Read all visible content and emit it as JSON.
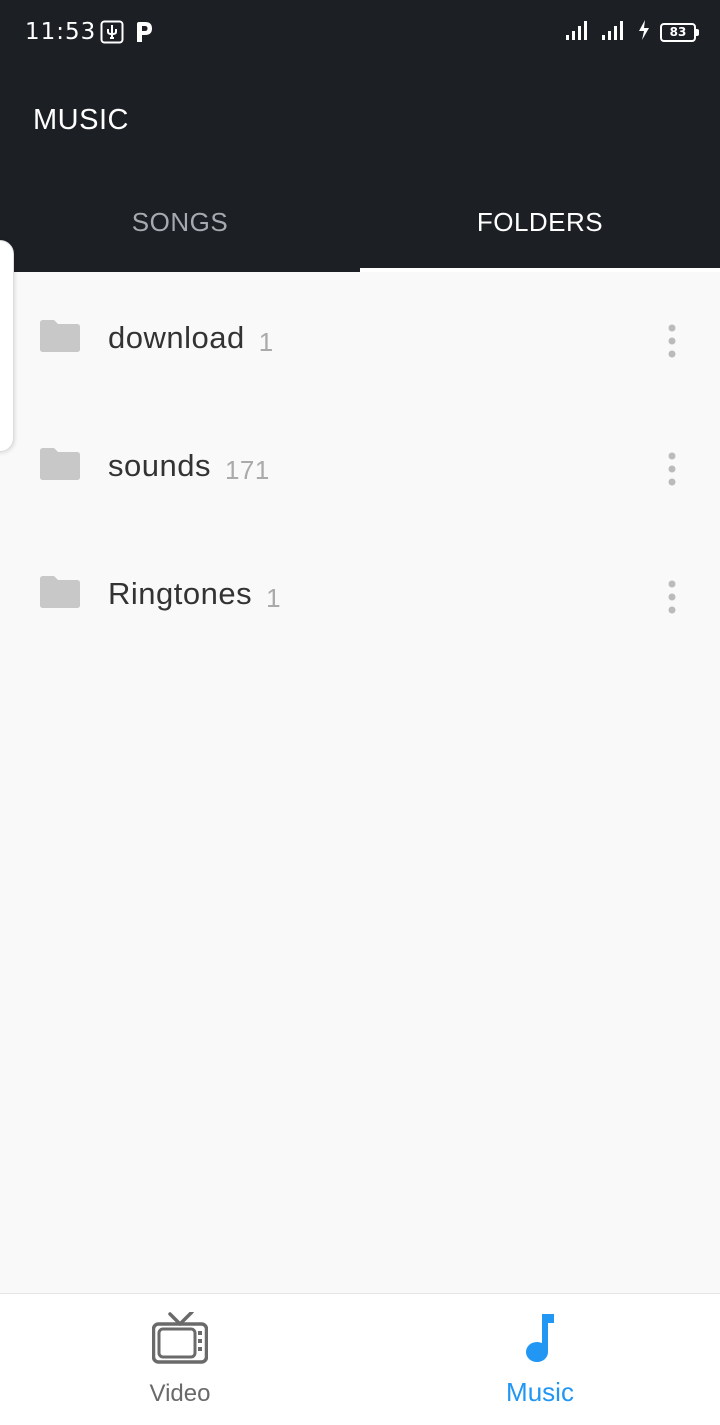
{
  "status_bar": {
    "time": "11:53",
    "battery_level": "83",
    "icons": [
      "usb-debug-icon",
      "parking-app-icon",
      "signal-1-icon",
      "signal-2-icon",
      "charging-icon",
      "battery-icon"
    ]
  },
  "app_bar": {
    "title": "MUSIC"
  },
  "tabs": [
    {
      "label": "SONGS",
      "selected": false
    },
    {
      "label": "FOLDERS",
      "selected": true
    }
  ],
  "folders": [
    {
      "name": "download",
      "count": "1"
    },
    {
      "name": "sounds",
      "count": "171"
    },
    {
      "name": "Ringtones",
      "count": "1"
    }
  ],
  "bottom_nav": [
    {
      "label": "Video",
      "icon": "tv-icon",
      "active": false
    },
    {
      "label": "Music",
      "icon": "music-note-icon",
      "active": true
    }
  ],
  "colors": {
    "app_bar_bg": "#1c1f24",
    "accent": "#2196f3",
    "folder_icon": "#c8c8c8",
    "tab_inactive": "#a6aab0",
    "background": "#f9f9f9"
  }
}
